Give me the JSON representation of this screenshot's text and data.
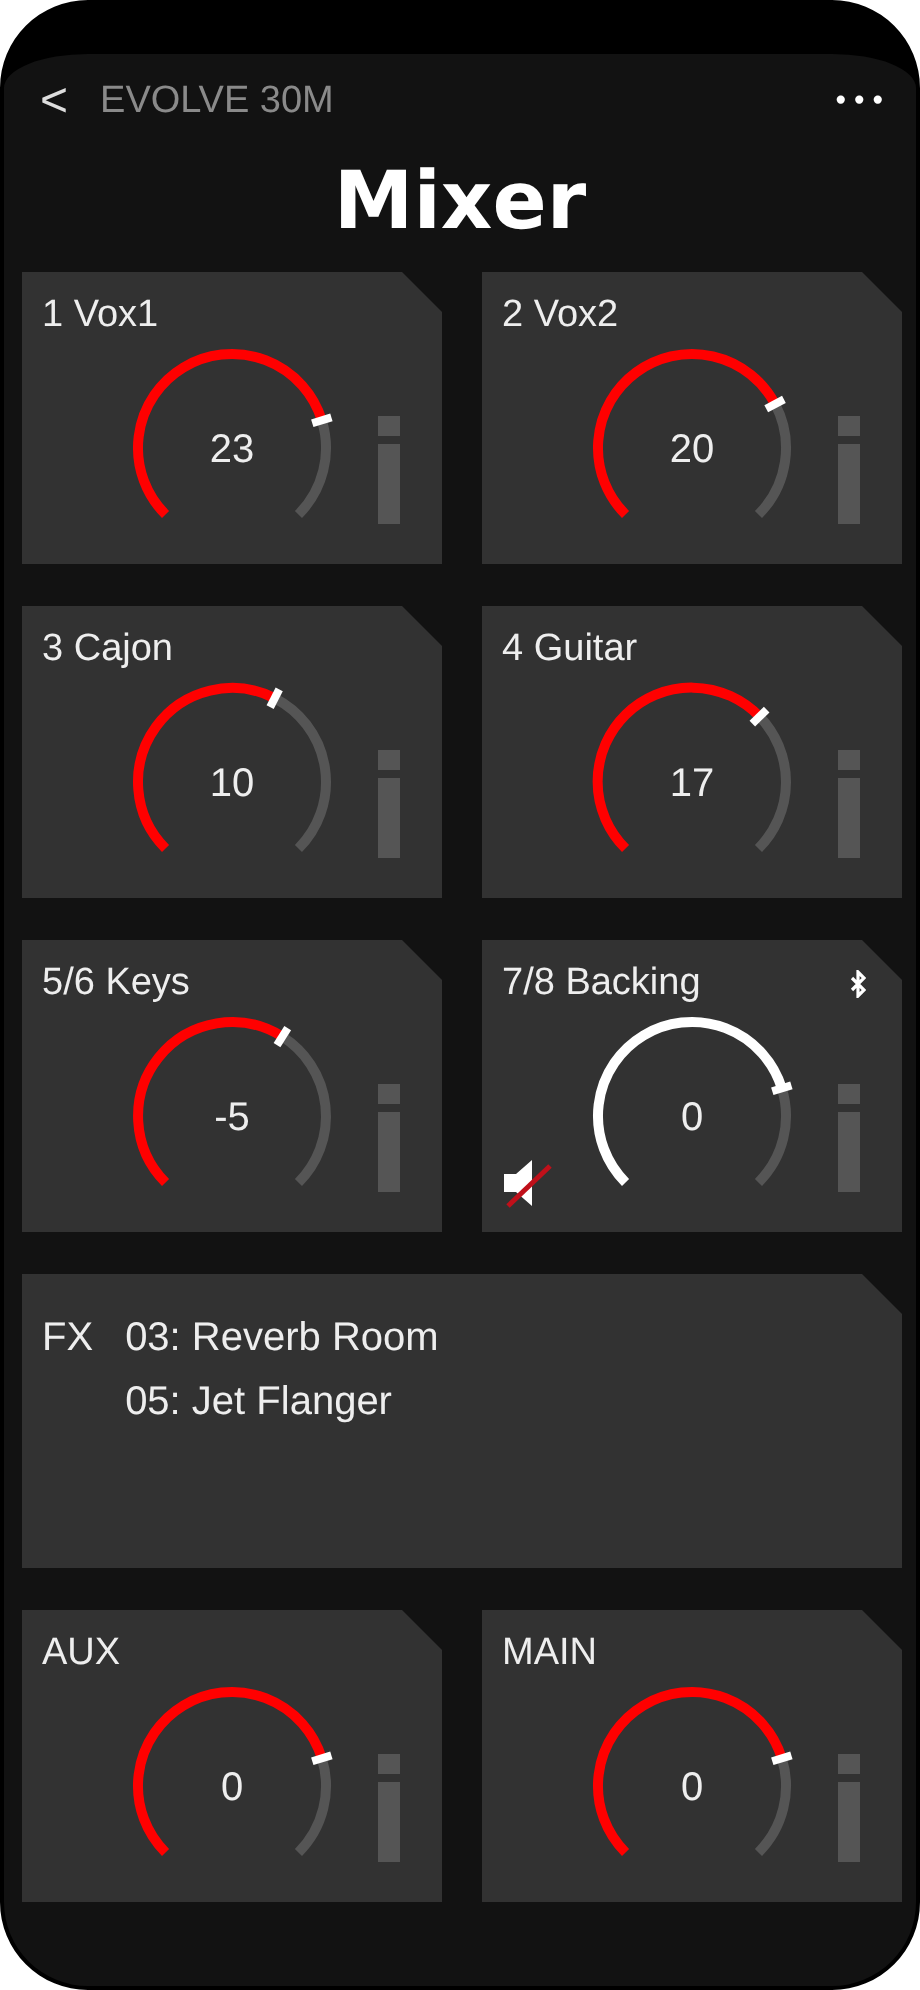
{
  "header": {
    "back": "<",
    "title": "EVOLVE 30M",
    "more": "•••"
  },
  "page_title": "Mixer",
  "channels": [
    {
      "name": "1 Vox1",
      "value": "23",
      "muted": false,
      "bluetooth": false
    },
    {
      "name": "2 Vox2",
      "value": "20",
      "muted": false,
      "bluetooth": false
    },
    {
      "name": "3 Cajon",
      "value": "10",
      "muted": false,
      "bluetooth": false
    },
    {
      "name": "4 Guitar",
      "value": "17",
      "muted": false,
      "bluetooth": false
    },
    {
      "name": "5/6 Keys",
      "value": "-5",
      "muted": false,
      "bluetooth": false
    },
    {
      "name": "7/8 Backing",
      "value": "0",
      "muted": true,
      "bluetooth": true
    }
  ],
  "fx": {
    "label": "FX",
    "effects": [
      "03: Reverb Room",
      "05: Jet Flanger"
    ]
  },
  "outputs": [
    {
      "name": "AUX",
      "value": "0",
      "muted": false,
      "bluetooth": false
    },
    {
      "name": "MAIN",
      "value": "0",
      "muted": false,
      "bluetooth": false
    }
  ]
}
